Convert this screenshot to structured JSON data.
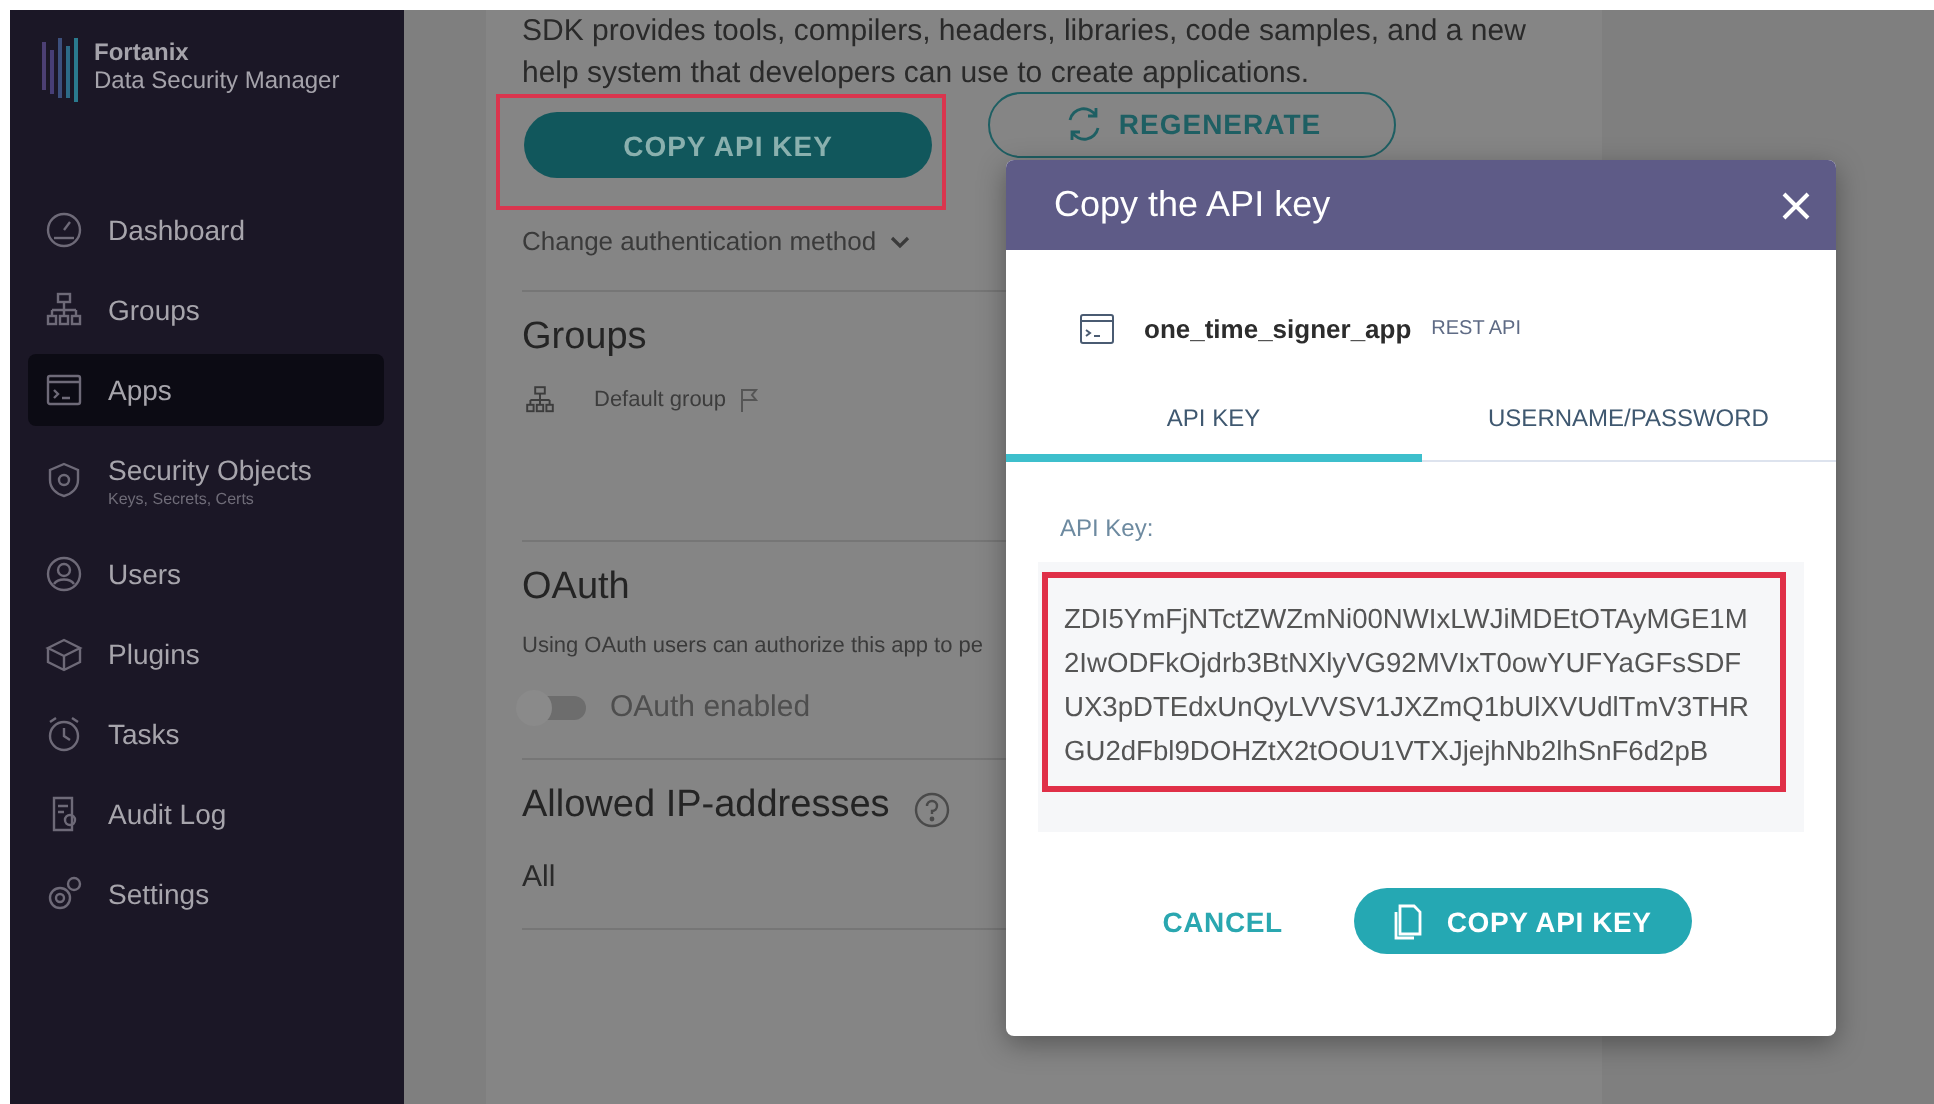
{
  "sidebar": {
    "brand": {
      "name": "Fortanix",
      "product": "Data Security Manager"
    },
    "items": [
      {
        "label": "Dashboard",
        "selected": false
      },
      {
        "label": "Groups",
        "selected": false
      },
      {
        "label": "Apps",
        "selected": true
      },
      {
        "label": "Security Objects",
        "sublabel": "Keys, Secrets, Certs",
        "selected": false
      },
      {
        "label": "Users",
        "selected": false
      },
      {
        "label": "Plugins",
        "selected": false
      },
      {
        "label": "Tasks",
        "selected": false
      },
      {
        "label": "Audit Log",
        "selected": false
      },
      {
        "label": "Settings",
        "selected": false
      }
    ]
  },
  "main": {
    "intro": "SDK provides tools, compilers, headers, libraries, code samples, and a new help system that developers can use to create applications.",
    "buttons": [
      {
        "label": "COPY API KEY",
        "kind": "primary",
        "highlighted": true
      },
      {
        "label": "REGENERATE",
        "kind": "outline",
        "highlighted": false
      }
    ],
    "auth_link": "Change authentication method",
    "groups": {
      "title": "Groups",
      "items": [
        "Default group"
      ]
    },
    "oauth": {
      "title": "OAuth",
      "description": "Using OAuth users can authorize this app to pe",
      "toggle": {
        "label": "OAuth enabled",
        "on": false
      }
    },
    "ip": {
      "title": "Allowed IP-addresses",
      "value": "All"
    }
  },
  "dialog": {
    "title": "Copy the API key",
    "app": {
      "name": "one_time_signer_app",
      "type": "REST API"
    },
    "tabs": [
      {
        "label": "API KEY",
        "selected": true
      },
      {
        "label": "USERNAME/PASSWORD",
        "selected": false
      }
    ],
    "key_label": "API Key:",
    "key_value": "ZDI5YmFjNTctZWZmNi00NWIxLWJiMDEtOTAyMGE1M2IwODFkOjdrb3BtNXlyVG92MVIxT0owYUFYaGFsSDFUX3pDTEdxUnQyLVVSV1JXZmQ1bUlXVUdlTmV3THRGU2dFbl9DOHZtX2tOOU1VTXJjejhNb2lhSnF6d2pB",
    "key_highlighted": true,
    "buttons": [
      {
        "label": "CANCEL",
        "kind": "text"
      },
      {
        "label": "COPY API KEY",
        "kind": "primary"
      }
    ]
  }
}
